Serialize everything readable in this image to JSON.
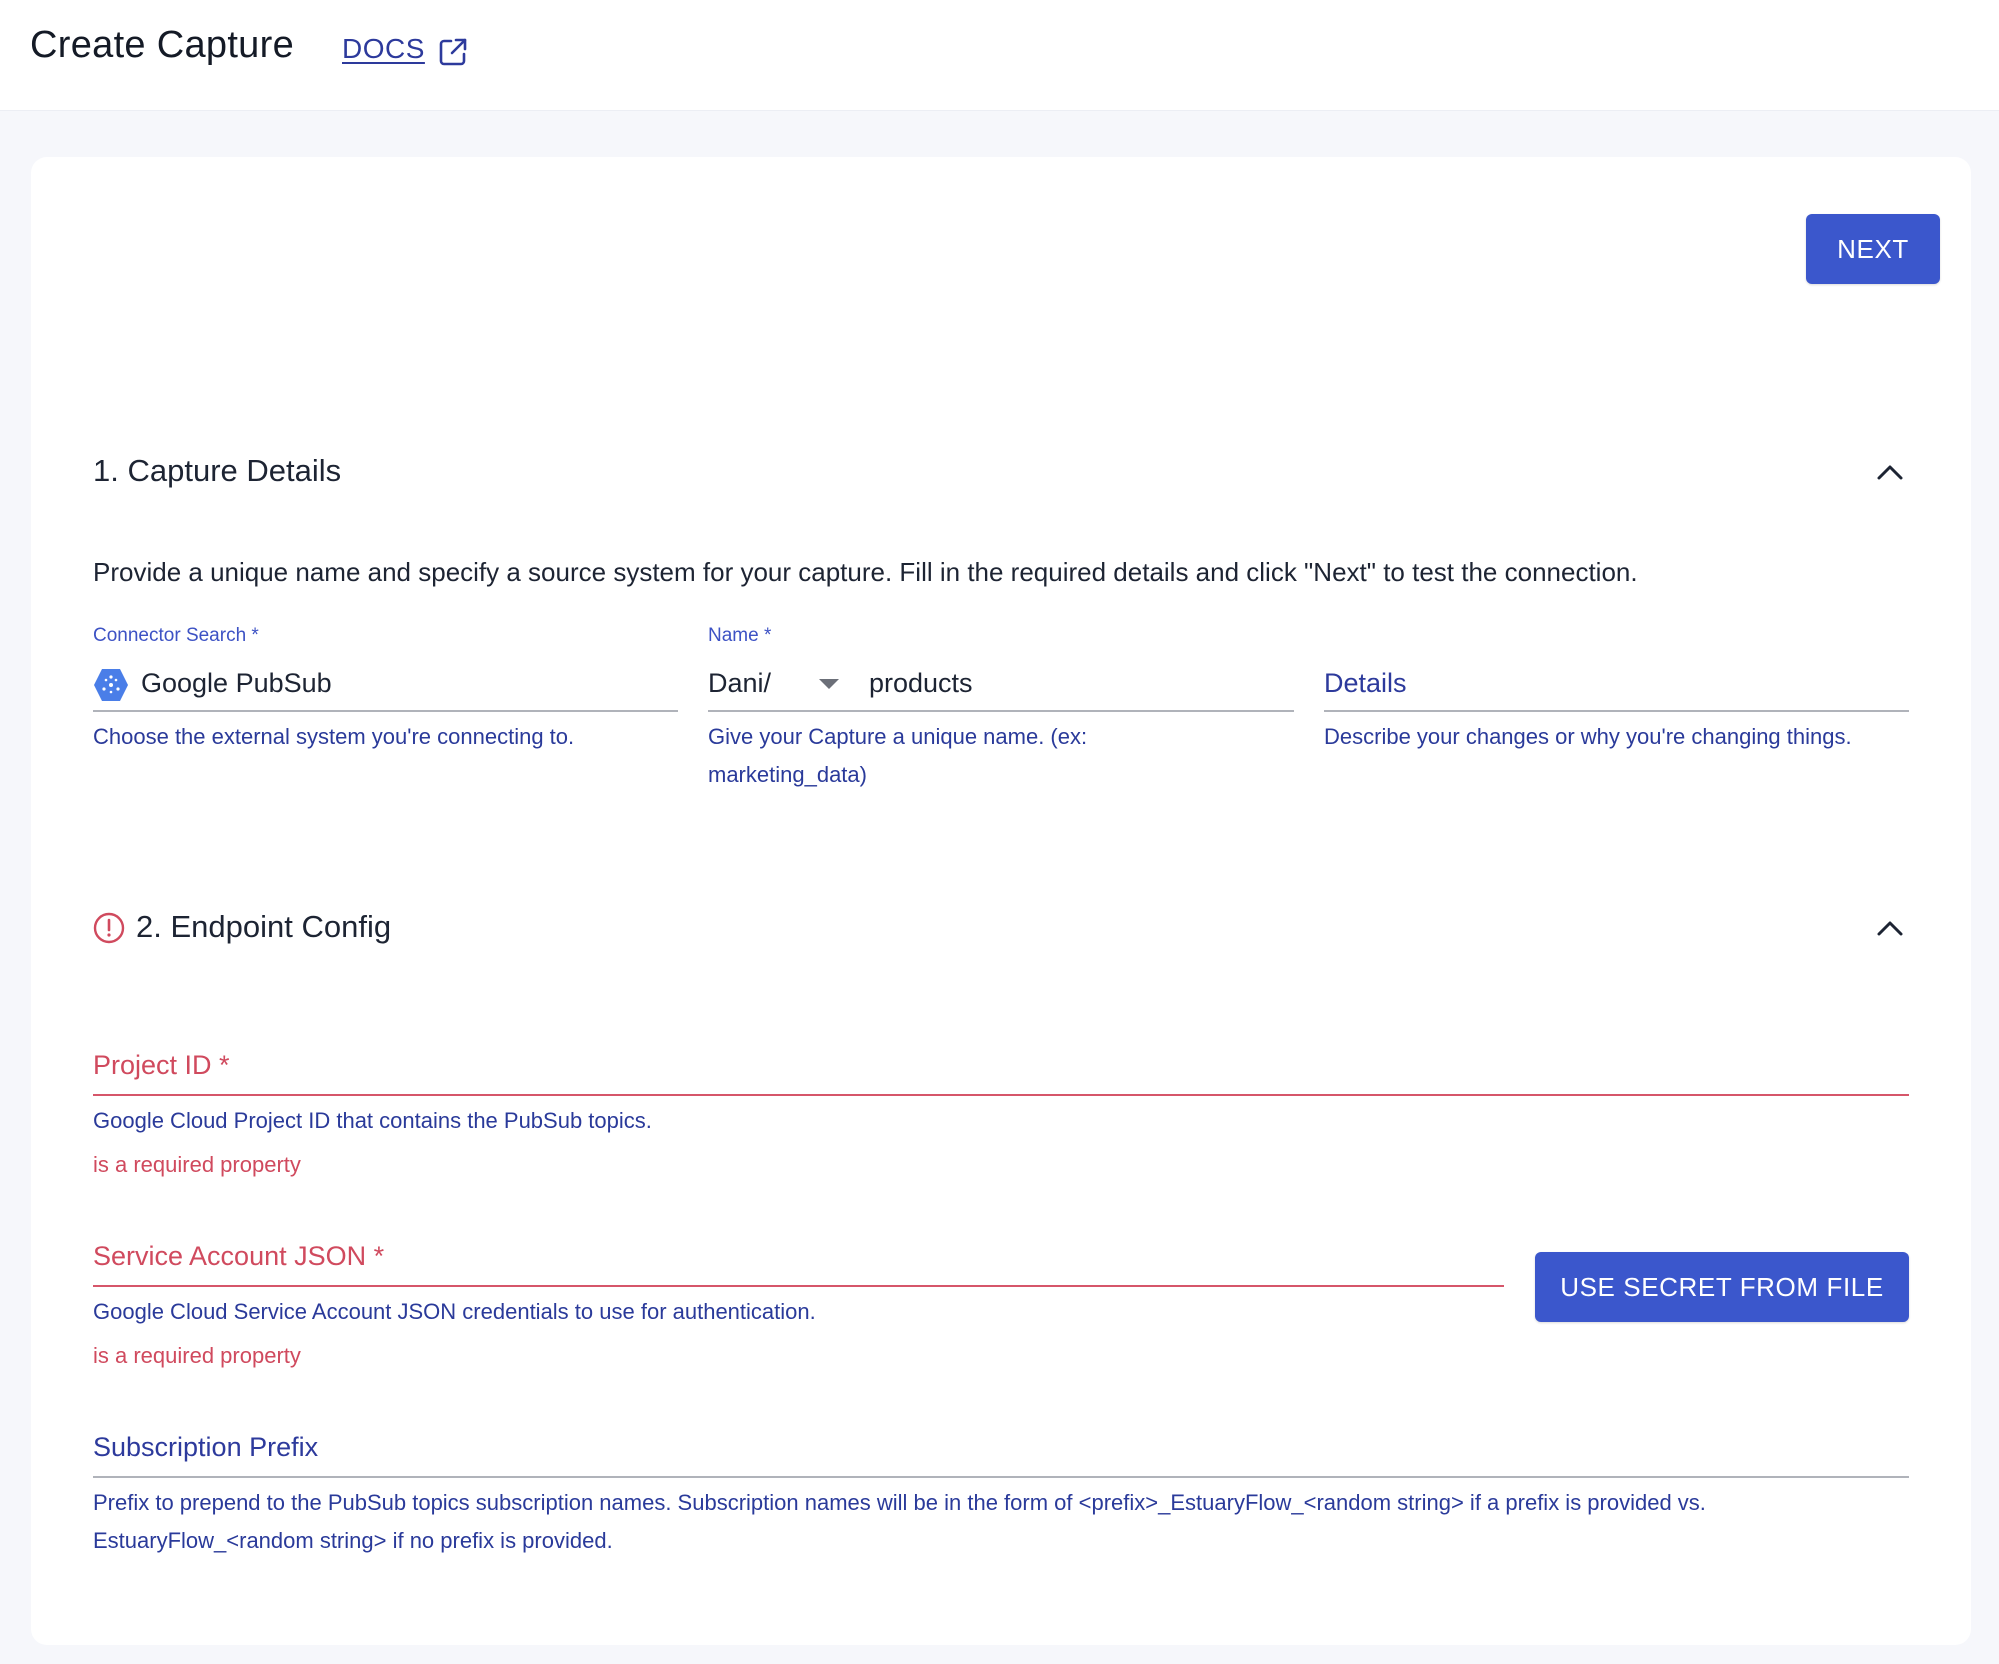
{
  "header": {
    "title": "Create Capture",
    "docs_label": "DOCS"
  },
  "toolbar": {
    "next_label": "NEXT"
  },
  "colors": {
    "primary": "#3b57cc",
    "error": "#d04a5e",
    "helper": "#2a3a9a"
  },
  "capture_details": {
    "title": "1. Capture Details",
    "description": "Provide a unique name and specify a source system for your capture. Fill in the required details and click \"Next\" to test the connection.",
    "connector": {
      "label": "Connector Search *",
      "value": "Google PubSub",
      "icon": "google-pubsub-icon",
      "helper": "Choose the external system you're connecting to."
    },
    "name": {
      "label": "Name *",
      "prefix": "Dani/",
      "value": "products",
      "helper": "Give your Capture a unique name. (ex: marketing_data)"
    },
    "details": {
      "placeholder": "Details",
      "helper": "Describe your changes or why you're changing things."
    }
  },
  "endpoint_config": {
    "title": "2. Endpoint Config",
    "status_icon": "error-icon",
    "project_id": {
      "label": "Project ID *",
      "helper": "Google Cloud Project ID that contains the PubSub topics.",
      "error": "is a required property"
    },
    "service_account": {
      "label": "Service Account JSON *",
      "helper": "Google Cloud Service Account JSON credentials to use for authentication.",
      "error": "is a required property",
      "button_label": "USE SECRET FROM FILE"
    },
    "subscription_prefix": {
      "label": "Subscription Prefix",
      "helper": "Prefix to prepend to the PubSub topics subscription names. Subscription names will be in the form of <prefix>_EstuaryFlow_<random string> if a prefix is provided vs. EstuaryFlow_<random string> if no prefix is provided."
    }
  }
}
